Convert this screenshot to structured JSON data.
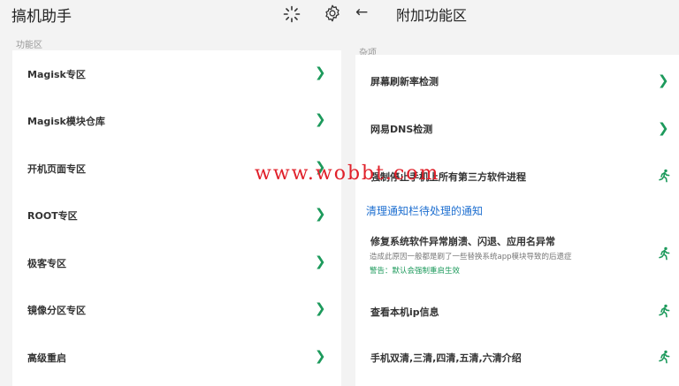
{
  "header": {
    "app_title": "搞机助手",
    "back_glyph": "←",
    "page_title": "附加功能区"
  },
  "left": {
    "section_label": "功能区",
    "items": [
      {
        "label": "Magisk专区"
      },
      {
        "label": "Magisk模块仓库"
      },
      {
        "label": "开机页面专区"
      },
      {
        "label": "ROOT专区"
      },
      {
        "label": "极客专区"
      },
      {
        "label": "镜像分区专区"
      },
      {
        "label": "高级重启"
      }
    ],
    "chevron_glyph": "❯"
  },
  "right": {
    "section_label": "杂项",
    "items": [
      {
        "label": "屏幕刷新率检测"
      },
      {
        "label": "网易DNS检测"
      },
      {
        "label": "强制停止手机上所有第三方软件进程"
      },
      {
        "label": "修复系统软件异常崩溃、闪退、应用名异常"
      },
      {
        "label": "查看本机ip信息"
      },
      {
        "label": "手机双清,三清,四清,五清,六清介绍"
      }
    ],
    "link_text": "清理通知栏待处理的通知",
    "fix_desc": "造成此原因一般都是刷了一些替换系统app模块导致的后遗症",
    "fix_warn": "警告：默认会强制重启生效",
    "chevron_glyph": "❯"
  },
  "watermark": "www.wobbt.com",
  "colors": {
    "accent_green": "#1d9a5c",
    "link_blue": "#1e6fd0",
    "watermark_red": "#e0202a"
  }
}
